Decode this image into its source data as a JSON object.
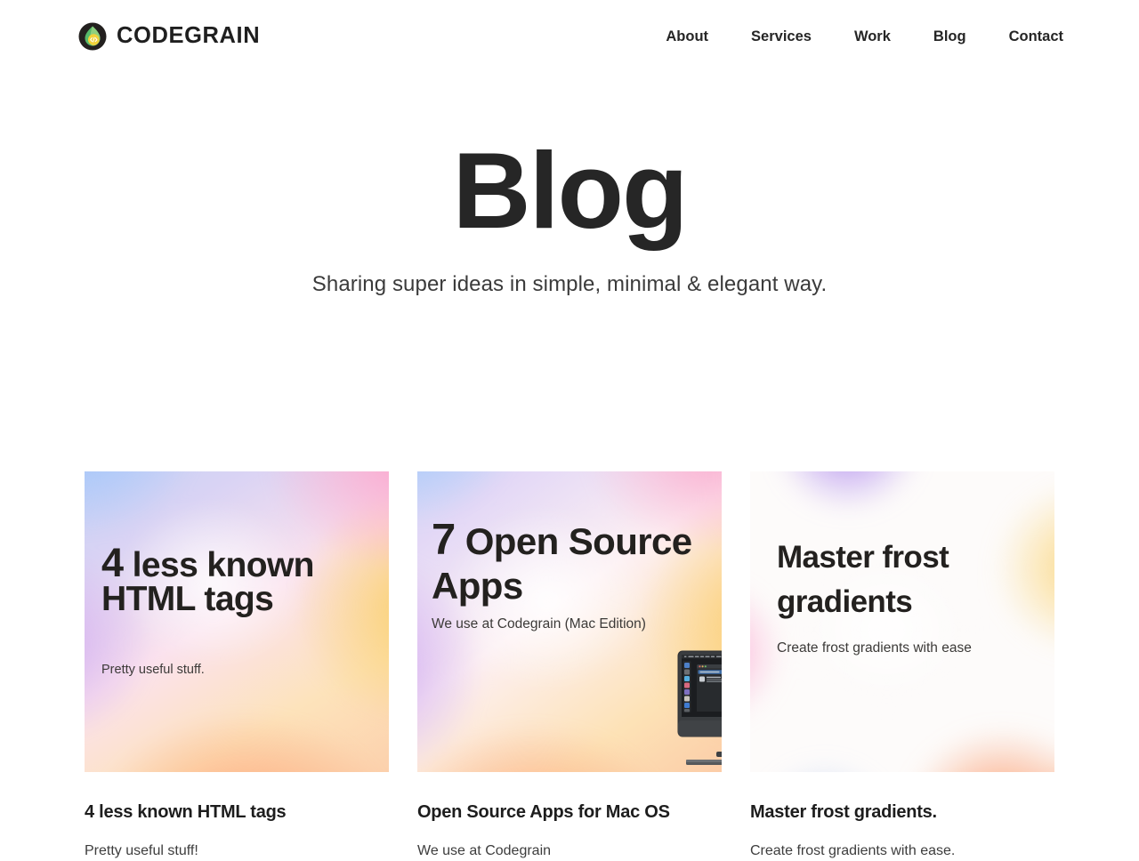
{
  "header": {
    "brand_name": "CODEGRAIN",
    "logo_icon": "codegrain-leaf-code-logo",
    "nav": [
      {
        "label": "About"
      },
      {
        "label": "Services"
      },
      {
        "label": "Work"
      },
      {
        "label": "Blog"
      },
      {
        "label": "Contact"
      }
    ]
  },
  "hero": {
    "title": "Blog",
    "subtitle": "Sharing super ideas in simple, minimal & elegant way."
  },
  "posts": [
    {
      "thumb_headline_lead": "4",
      "thumb_headline_rest": " less known HTML tags",
      "thumb_sub": "Pretty useful stuff.",
      "title": "4 less known HTML tags",
      "excerpt": "Pretty useful stuff!"
    },
    {
      "thumb_headline_lead": "7",
      "thumb_headline_rest": " Open Source Apps",
      "thumb_sub": "We use at Codegrain (Mac Edition)",
      "title": "Open Source Apps for Mac OS",
      "excerpt": "We use at Codegrain"
    },
    {
      "thumb_headline_lead": "",
      "thumb_headline_rest": "Master frost gradients",
      "thumb_sub": "Create frost gradients with ease",
      "title": "Master frost gradients.",
      "excerpt": "Create frost gradients with ease."
    }
  ],
  "colors": {
    "text_primary": "#262626",
    "text_secondary": "#3d3d3d",
    "page_background": "#ffffff",
    "logo_dark": "#23201f",
    "logo_green": "#4caf6d",
    "logo_yellow": "#f2d23a"
  }
}
